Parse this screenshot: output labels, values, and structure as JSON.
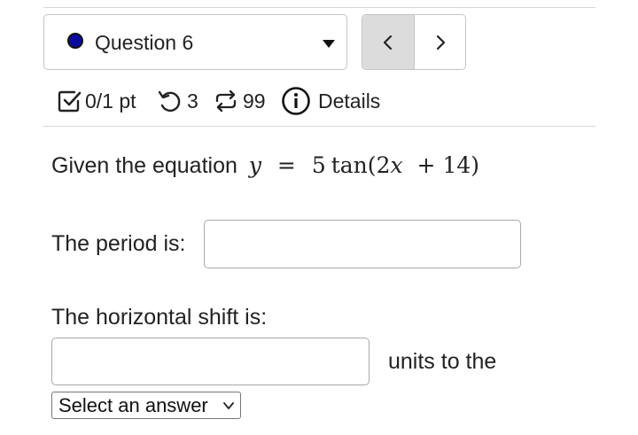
{
  "question_selector": {
    "label": "Question 6",
    "status_color": "#0a0a9e"
  },
  "nav": {
    "prev_icon": "chevron-left-icon",
    "next_icon": "chevron-right-icon"
  },
  "meta": {
    "score": "0/1 pt",
    "attempts": "3",
    "versions": "99",
    "details_label": "Details"
  },
  "problem": {
    "prompt_text": "Given the equation",
    "equation": {
      "lhs": "y",
      "eq": "=",
      "coef": "5",
      "func": "tan",
      "open": "(",
      "a": "2",
      "var": "x",
      "plus": "+",
      "b": "14",
      "close": ")"
    },
    "period_label": "The period is:",
    "period_value": "",
    "shift_label": "The horizontal shift is:",
    "shift_value": "",
    "units_text": "units to the",
    "direction_select": "Select an answer"
  }
}
